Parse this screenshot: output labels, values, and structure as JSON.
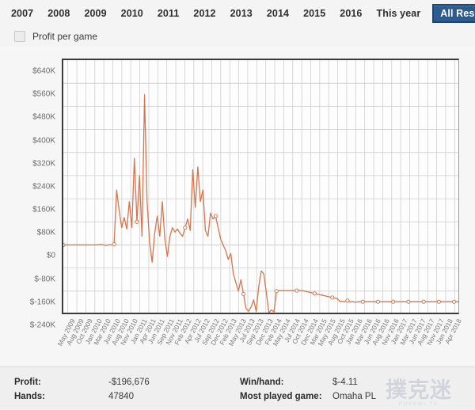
{
  "tabs": [
    {
      "label": "2007",
      "active": false
    },
    {
      "label": "2008",
      "active": false
    },
    {
      "label": "2009",
      "active": false
    },
    {
      "label": "2010",
      "active": false
    },
    {
      "label": "2011",
      "active": false
    },
    {
      "label": "2012",
      "active": false
    },
    {
      "label": "2013",
      "active": false
    },
    {
      "label": "2014",
      "active": false
    },
    {
      "label": "2015",
      "active": false
    },
    {
      "label": "2016",
      "active": false
    },
    {
      "label": "This year",
      "active": false
    },
    {
      "label": "All Results",
      "active": true
    }
  ],
  "options": {
    "profit_per_game_label": "Profit per game",
    "profit_per_game_checked": false
  },
  "footer": {
    "rows": [
      {
        "key": "Profit:",
        "value": "-$196,676",
        "key2": "Win/hand:",
        "value2": "$-4.11"
      },
      {
        "key": "Hands:",
        "value": "47840",
        "key2": "Most played game:",
        "value2": "Omaha PL"
      }
    ],
    "watermark": "撲克迷",
    "watermark_sub": "PUKEMI.TV"
  },
  "colors": {
    "accent": "#2c5b92",
    "line": "#d4764f",
    "plot_bg": "#fdfdfd",
    "grid": "#cfcfcf",
    "axis": "#3a3a3a",
    "page_bg": "#f4f4f4"
  },
  "chart_data": {
    "type": "line",
    "title": "",
    "xlabel": "",
    "ylabel": "",
    "ylim": [
      -240000,
      640000
    ],
    "ytick_step": 80000,
    "ytick_labels": [
      "$640K",
      "$560K",
      "$480K",
      "$400K",
      "$320K",
      "$240K",
      "$160K",
      "$80K",
      "$0",
      "$-80K",
      "$-160K",
      "$-240K"
    ],
    "ytick_values": [
      640000,
      560000,
      480000,
      400000,
      320000,
      240000,
      160000,
      80000,
      0,
      -80000,
      -160000,
      -240000
    ],
    "grid": true,
    "legend": "none",
    "x_tick_labels": [
      "May 2009",
      "Aug 2009",
      "Oct 2009",
      "Jan 2010",
      "Mar 2010",
      "Jun 2010",
      "Aug 2010",
      "Nov 2010",
      "Jan 2011",
      "Apr 2011",
      "Jun 2011",
      "Sep 2011",
      "Nov 2011",
      "Feb 2012",
      "Apr 2012",
      "Jul 2012",
      "Sep 2012",
      "Dec 2012",
      "Feb 2013",
      "May 2013",
      "Jul 2013",
      "Sep 2013",
      "Dec 2013",
      "Feb 2014",
      "May 2014",
      "Jul 2014",
      "Oct 2014",
      "Dec 2014",
      "Mar 2015",
      "May 2015",
      "Aug 2015",
      "Oct 2015",
      "Jan 2016",
      "Mar 2016",
      "Jun 2016",
      "Aug 2016",
      "Nov 2016",
      "Jan 2017",
      "Mar 2017",
      "Jun 2017",
      "Aug 2017",
      "Nov 2017",
      "Jan 2018",
      "Apr 2018"
    ],
    "series": [
      {
        "name": "Cumulative profit",
        "marker": "circle",
        "values": [
          0,
          0,
          0,
          0,
          0,
          0,
          0,
          0,
          0,
          0,
          0,
          0,
          0,
          0,
          1000,
          2000,
          0,
          -2000,
          1000,
          0,
          2000,
          190000,
          120000,
          60000,
          95000,
          55000,
          150000,
          60000,
          300000,
          80000,
          240000,
          30000,
          520000,
          150000,
          10000,
          -60000,
          40000,
          100000,
          30000,
          150000,
          20000,
          -40000,
          30000,
          60000,
          45000,
          55000,
          40000,
          30000,
          60000,
          90000,
          50000,
          260000,
          130000,
          270000,
          150000,
          190000,
          50000,
          30000,
          110000,
          90000,
          100000,
          60000,
          20000,
          0,
          -20000,
          -50000,
          -30000,
          -100000,
          -130000,
          -160000,
          -120000,
          -170000,
          -220000,
          -230000,
          -215000,
          -190000,
          -230000,
          -145000,
          -90000,
          -100000,
          -165000,
          -235000,
          -225000,
          -232000,
          -160000,
          -158000,
          -158000,
          -158000,
          -158000,
          -158000,
          -158000,
          -158000,
          -158000,
          -158000,
          -158000,
          -160000,
          -162000,
          -164000,
          -166000,
          -168000,
          -170000,
          -172000,
          -174000,
          -176000,
          -178000,
          -180000,
          -182000,
          -184000,
          -186000,
          -196000,
          -196000,
          -196000,
          -193000,
          -198000,
          -196000,
          -199000,
          -196676,
          -196676,
          -196676,
          -196676,
          -196676,
          -196676,
          -196676,
          -196676,
          -196676,
          -196676,
          -196676,
          -196676,
          -196676,
          -196676,
          -196676,
          -196676,
          -196676,
          -196676,
          -196676,
          -196676,
          -196676,
          -196676,
          -196676,
          -196676,
          -196676,
          -196676,
          -196676,
          -196676,
          -196676,
          -196676,
          -196676,
          -196676,
          -196676,
          -196676,
          -196676,
          -196676,
          -196676,
          -196676,
          -196676,
          -196676,
          -196676
        ],
        "marker_indices": [
          0,
          20,
          29,
          48,
          60,
          71,
          84,
          92,
          99,
          106,
          112,
          118,
          124,
          130,
          136,
          142,
          148,
          154,
          160
        ]
      }
    ]
  }
}
